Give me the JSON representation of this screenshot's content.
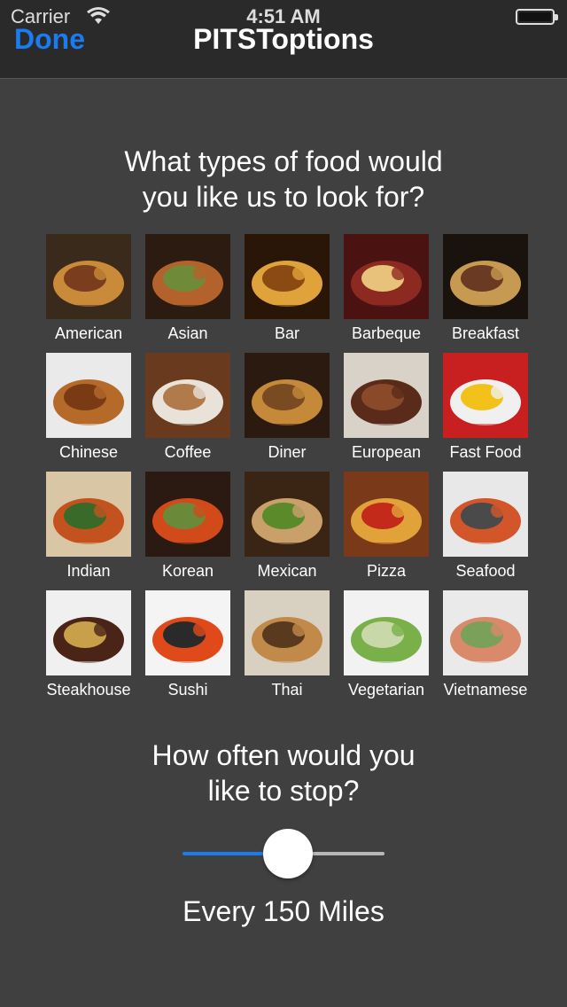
{
  "status_bar": {
    "carrier": "Carrier",
    "time": "4:51 AM"
  },
  "nav": {
    "done_label": "Done",
    "title": "PITSToptions"
  },
  "food_question": {
    "line1": "What types of food would",
    "line2": "you like us to look for?"
  },
  "food_types": [
    {
      "label": "American",
      "icon": "burger",
      "colors": [
        "#3a2a1c",
        "#c98a3a",
        "#7a3e1e"
      ]
    },
    {
      "label": "Asian",
      "icon": "noodles",
      "colors": [
        "#2b1b10",
        "#b4622c",
        "#6f8b3a"
      ]
    },
    {
      "label": "Bar",
      "icon": "beer-glasses",
      "colors": [
        "#2a1606",
        "#e0a23a",
        "#8a4a12"
      ]
    },
    {
      "label": "Barbeque",
      "icon": "ribs",
      "colors": [
        "#4a1210",
        "#8c2a22",
        "#e8c27a"
      ]
    },
    {
      "label": "Breakfast",
      "icon": "breakfast-plate",
      "colors": [
        "#1a120c",
        "#c79a52",
        "#6a3a22"
      ]
    },
    {
      "label": "Chinese",
      "icon": "chow-mein",
      "colors": [
        "#eaeaea",
        "#b56a2a",
        "#7a3a14"
      ]
    },
    {
      "label": "Coffee",
      "icon": "latte-cup",
      "colors": [
        "#6a3a1e",
        "#e9e2d8",
        "#b07a4a"
      ]
    },
    {
      "label": "Diner",
      "icon": "diner-table",
      "colors": [
        "#2a1a10",
        "#c48a3a",
        "#7a4a22"
      ]
    },
    {
      "label": "European",
      "icon": "steak-plate",
      "colors": [
        "#d8d2c8",
        "#5a2a1a",
        "#8a4a2a"
      ]
    },
    {
      "label": "Fast Food",
      "icon": "fast-food-bag",
      "colors": [
        "#c82020",
        "#f0f0f0",
        "#f2c21a"
      ]
    },
    {
      "label": "Indian",
      "icon": "curry",
      "colors": [
        "#d9c6a4",
        "#c4521e",
        "#3a6a2a"
      ]
    },
    {
      "label": "Korean",
      "icon": "hot-pot",
      "colors": [
        "#2a1a12",
        "#d24a1a",
        "#6a8a3a"
      ]
    },
    {
      "label": "Mexican",
      "icon": "tacos",
      "colors": [
        "#3a2414",
        "#c9a06a",
        "#5a8a2a"
      ]
    },
    {
      "label": "Pizza",
      "icon": "pizza",
      "colors": [
        "#7a3a1a",
        "#e2a23a",
        "#c42a1a"
      ]
    },
    {
      "label": "Seafood",
      "icon": "salmon",
      "colors": [
        "#e8e8e8",
        "#d2562a",
        "#4a4a4a"
      ]
    },
    {
      "label": "Steakhouse",
      "icon": "grilled-steak",
      "colors": [
        "#f0f0f0",
        "#4a2416",
        "#c8a04a"
      ]
    },
    {
      "label": "Sushi",
      "icon": "sushi-rolls",
      "colors": [
        "#f4f4f4",
        "#e04a1a",
        "#2a2a2a"
      ]
    },
    {
      "label": "Thai",
      "icon": "pad-thai",
      "colors": [
        "#d8d0c0",
        "#c28a4a",
        "#5a3a1e"
      ]
    },
    {
      "label": "Vegetarian",
      "icon": "salad",
      "colors": [
        "#f2f2f2",
        "#7ab04a",
        "#c8d8a8"
      ]
    },
    {
      "label": "Vietnamese",
      "icon": "spring-rolls",
      "colors": [
        "#eaeaea",
        "#d88a6a",
        "#7aa05a"
      ]
    }
  ],
  "frequency_question": {
    "line1": "How often would you",
    "line2": "like to stop?"
  },
  "frequency_slider": {
    "value_fraction": 0.46
  },
  "frequency_label": "Every 150 Miles",
  "colors": {
    "accent": "#1a7cf0",
    "background": "#404040",
    "navbar": "#2a2a2a"
  }
}
